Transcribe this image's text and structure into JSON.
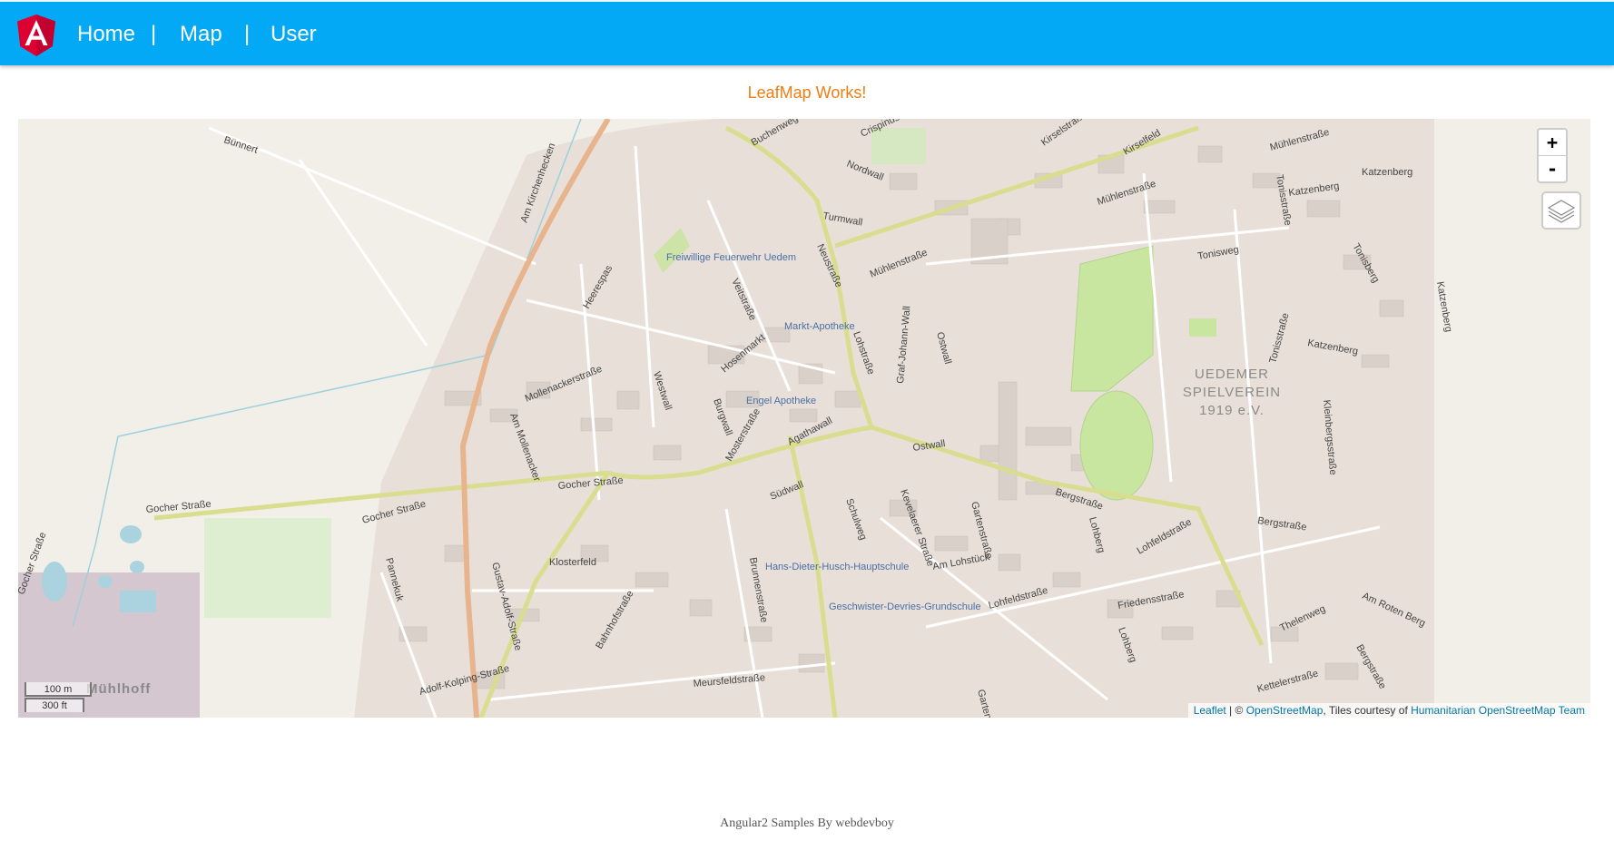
{
  "navbar": {
    "links": [
      "Home",
      "Map",
      "User"
    ],
    "separator": "|",
    "logo_icon": "angular-logo-icon",
    "background": "#03a9f4"
  },
  "headline": "LeafMap Works!",
  "map": {
    "zoom_in": "+",
    "zoom_out": "-",
    "layers_icon": "layers-icon",
    "scale_metric": "100 m",
    "scale_imperial": "300 ft",
    "attribution": {
      "leaflet": "Leaflet",
      "sep1": " | © ",
      "osm": "OpenStreetMap",
      "tiles": ", Tiles courtesy of ",
      "hot": "Humanitarian OpenStreetMap Team"
    },
    "streets": [
      "Bünnert",
      "Am Kirchenhecken",
      "Nordwall",
      "Mühlenstraße",
      "Mühlenstraße",
      "Mühlenstraße",
      "Kirselstraße",
      "Kirselfeld",
      "Katzenberg",
      "Katzenberg",
      "Katzenberg",
      "Katzenberg",
      "Tonisstraße",
      "Tonisstraße",
      "Tonisweg",
      "Tonisberg",
      "Crispinus",
      "Buchenweg",
      "Turmwall",
      "Neustraße",
      "Veitstraße",
      "Heerespas",
      "Ostwall",
      "Ostwall",
      "Graf-Johann-Wall",
      "Lohstraße",
      "Hosenmarkt",
      "Westwall",
      "Mollenackerstraße",
      "Am Mollenacker",
      "Burgwall",
      "Mosterstraße",
      "Agathawall",
      "Südwall",
      "Gocher Straße",
      "Gocher Straße",
      "Gocher Straße",
      "Gocher Straße",
      "Bergstraße",
      "Bergstraße",
      "Bergstraße",
      "Kleinbergsstraße",
      "Klosterfeld",
      "Pannekuk",
      "Gustav-Adolf-Straße",
      "Bahnhofstraße",
      "Brunnenstraße",
      "Kevelaerer Straße",
      "Schulweg",
      "Gartenstraße",
      "Gartenstraße",
      "Am Lohstück",
      "Lohfeldstraße",
      "Lohfeldstraße",
      "Lohberg",
      "Lohberg",
      "Friedensstraße",
      "Thelenweg",
      "Am Roten Berg",
      "Kettelerstraße",
      "Meursfeldstraße",
      "Adolf-Kolping-Straße"
    ],
    "pois": [
      "Freiwillige Feuerwehr Uedem",
      "Markt-Apotheke",
      "Engel Apotheke",
      "Hans-Dieter-Husch-Hauptschule",
      "Geschwister-Devries-Grundschule"
    ],
    "area_label": [
      "UEDEMER",
      "SPIELVEREIN",
      "1919 e.V."
    ],
    "place_label": "Mühlhoff"
  },
  "footer": "Angular2 Samples By webdevboy"
}
